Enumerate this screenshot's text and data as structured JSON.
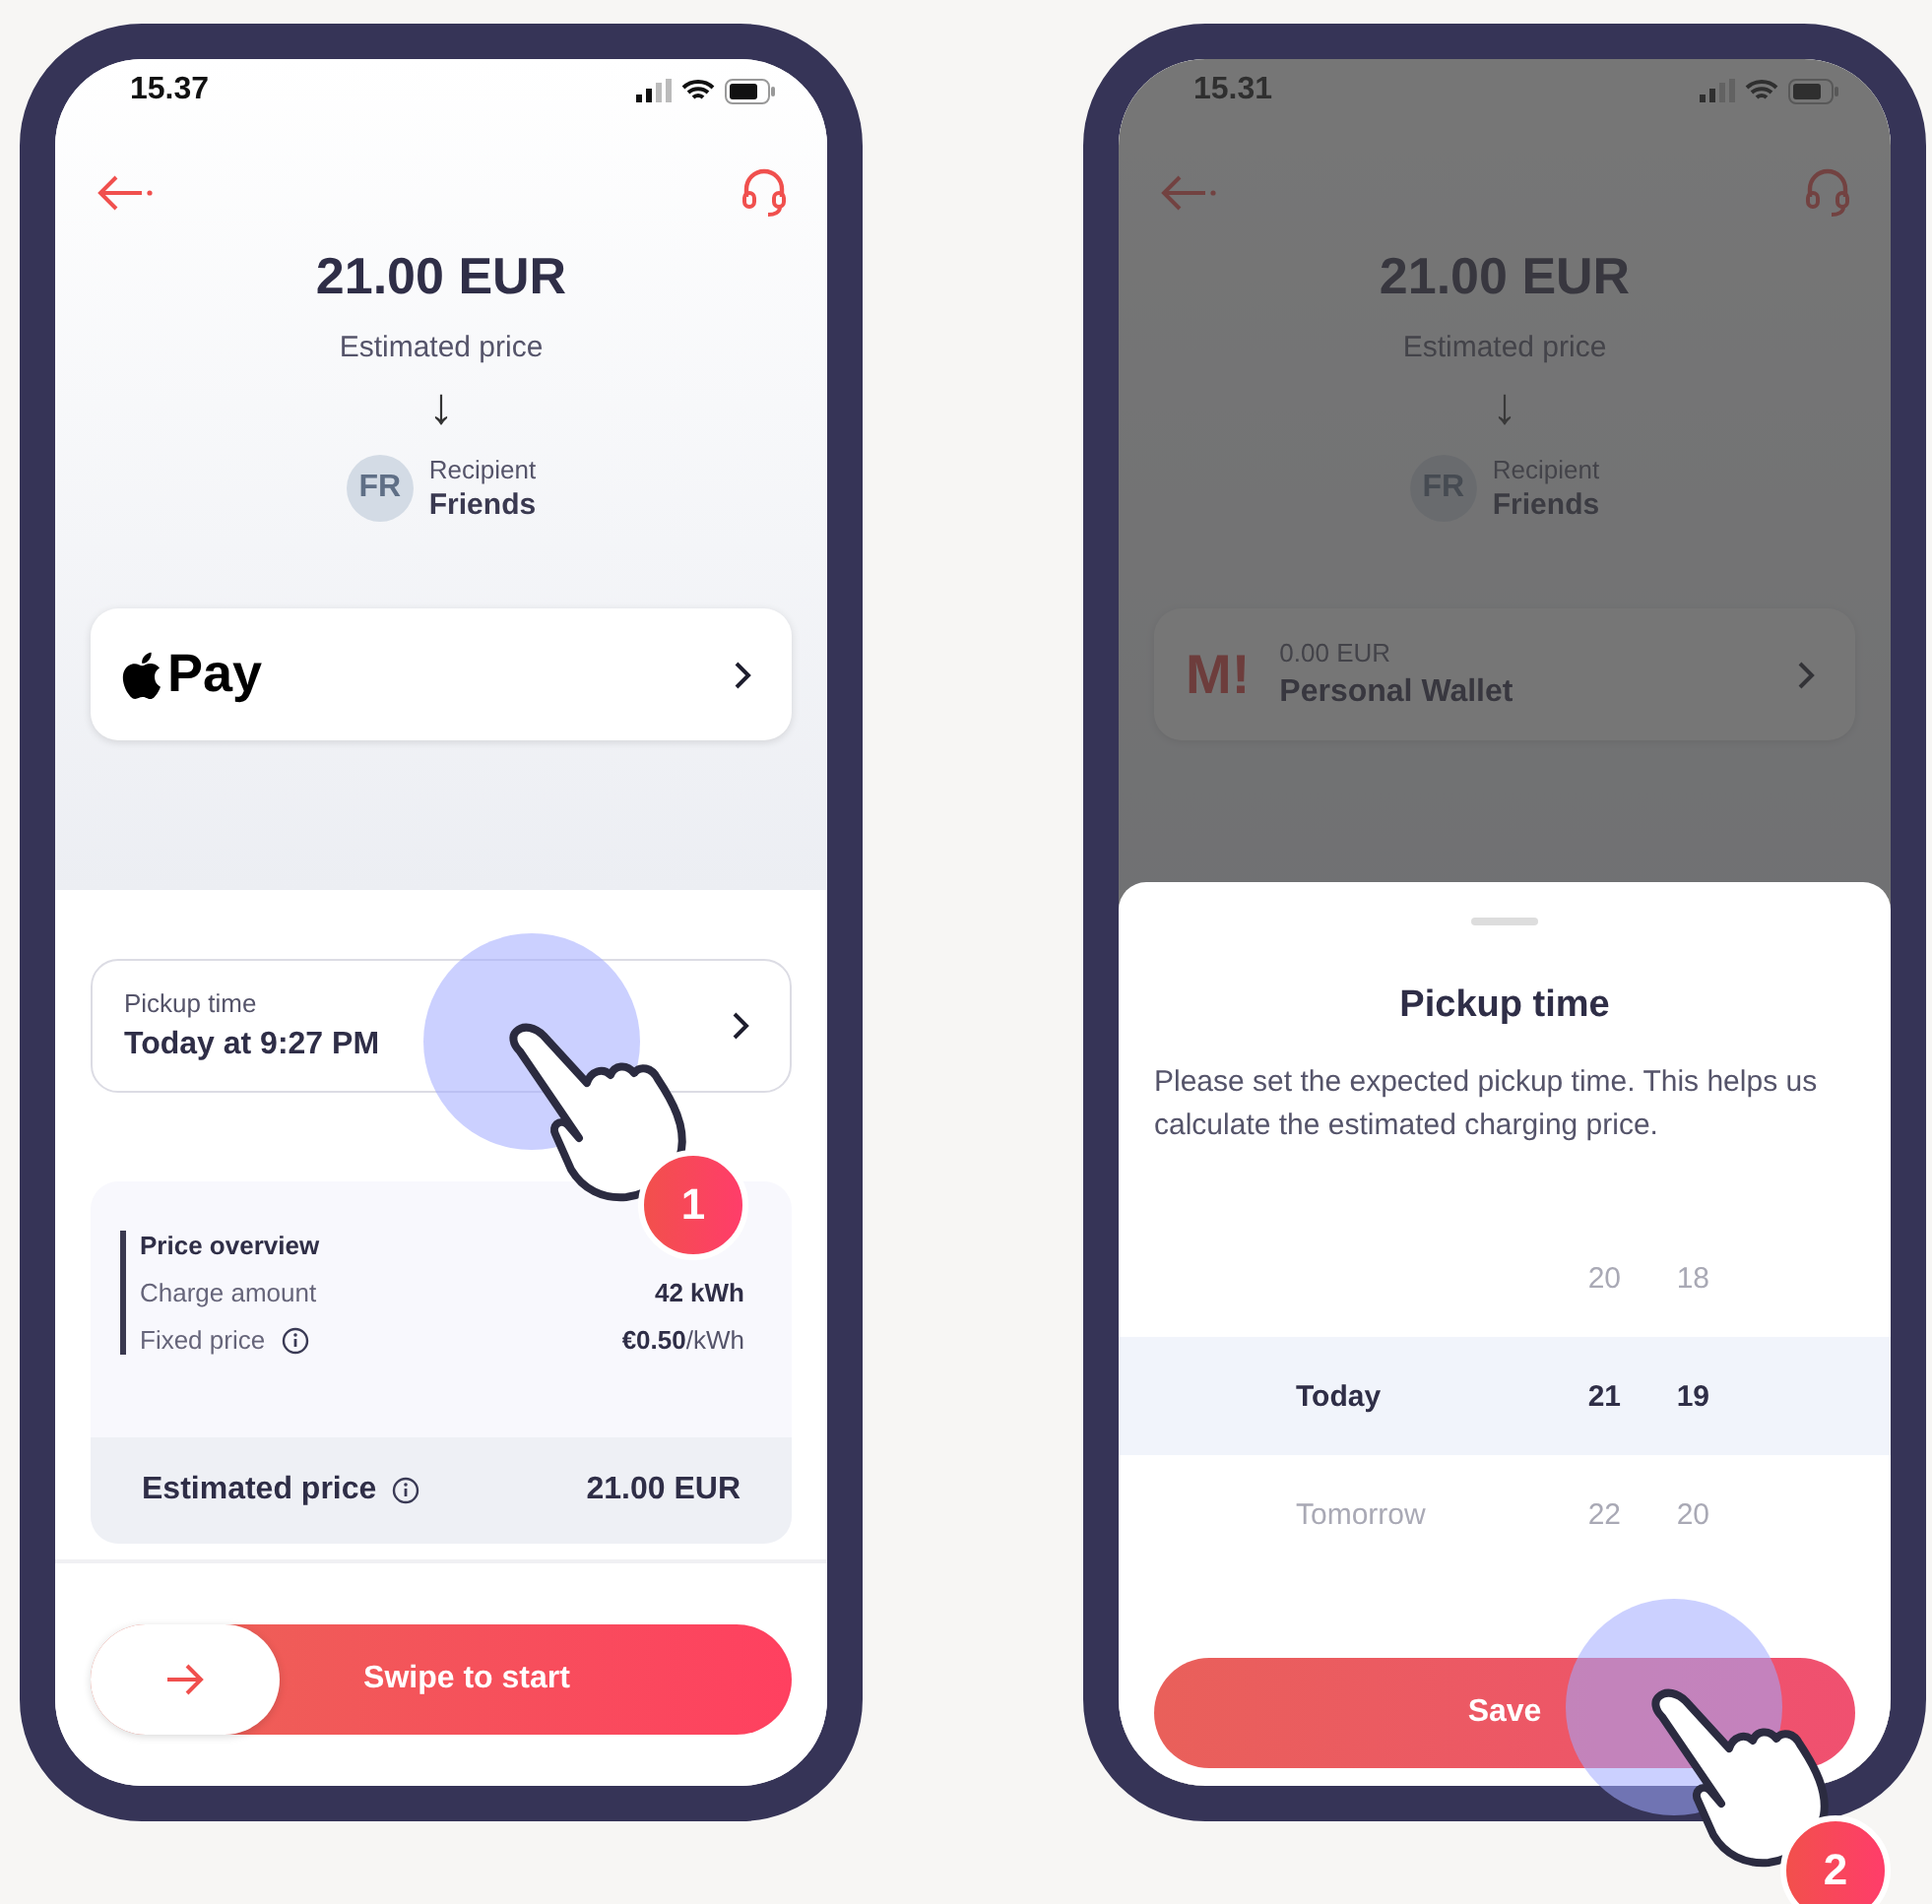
{
  "phones": [
    {
      "status_bar": {
        "time": "15.37"
      },
      "dimmed": false,
      "summary": {
        "amount": "21.00 EUR",
        "caption": "Estimated price",
        "arrow": "↓"
      },
      "recipient": {
        "initials": "FR",
        "label": "Recipient",
        "name": "Friends"
      },
      "payment": {
        "kind": "apple_pay",
        "label": "Pay"
      },
      "pickup": {
        "label": "Pickup time",
        "value": "Today at 9:27 PM"
      },
      "price_overview": {
        "title": "Price overview",
        "rows": [
          {
            "label": "Charge amount",
            "value": "42 kWh",
            "value_bold": true,
            "info": false
          },
          {
            "label": "Fixed price",
            "value": "**€0.50**/kWh",
            "value_bold": false,
            "info": true
          }
        ],
        "total": {
          "label": "Estimated price",
          "info": true,
          "value": "21.00 EUR"
        }
      },
      "swipe": {
        "label": "Swipe to start",
        "level": 0
      },
      "tap_hint": {
        "number": "1"
      }
    },
    {
      "status_bar": {
        "time": "15.31"
      },
      "dimmed": true,
      "summary": {
        "amount": "21.00 EUR",
        "caption": "Estimated price",
        "arrow": "↓"
      },
      "recipient": {
        "initials": "FR",
        "label": "Recipient",
        "name": "Friends"
      },
      "payment": {
        "kind": "wallet",
        "logo": "M!",
        "balance": "0.00 EUR",
        "label": "Personal Wallet"
      },
      "sheet": {
        "title": "Pickup time",
        "description": "Please set the expected pickup time. This helps us calculate the estimated charging price.",
        "picker": [
          {
            "hour": "20",
            "minute": "18",
            "selected": false
          },
          {
            "day": "Today",
            "hour": "21",
            "minute": "19",
            "selected": true
          },
          {
            "day": "Tomorrow",
            "hour": "22",
            "minute": "20",
            "selected": false
          }
        ],
        "button": "Save"
      },
      "tap_hint": {
        "number": "2"
      }
    }
  ]
}
